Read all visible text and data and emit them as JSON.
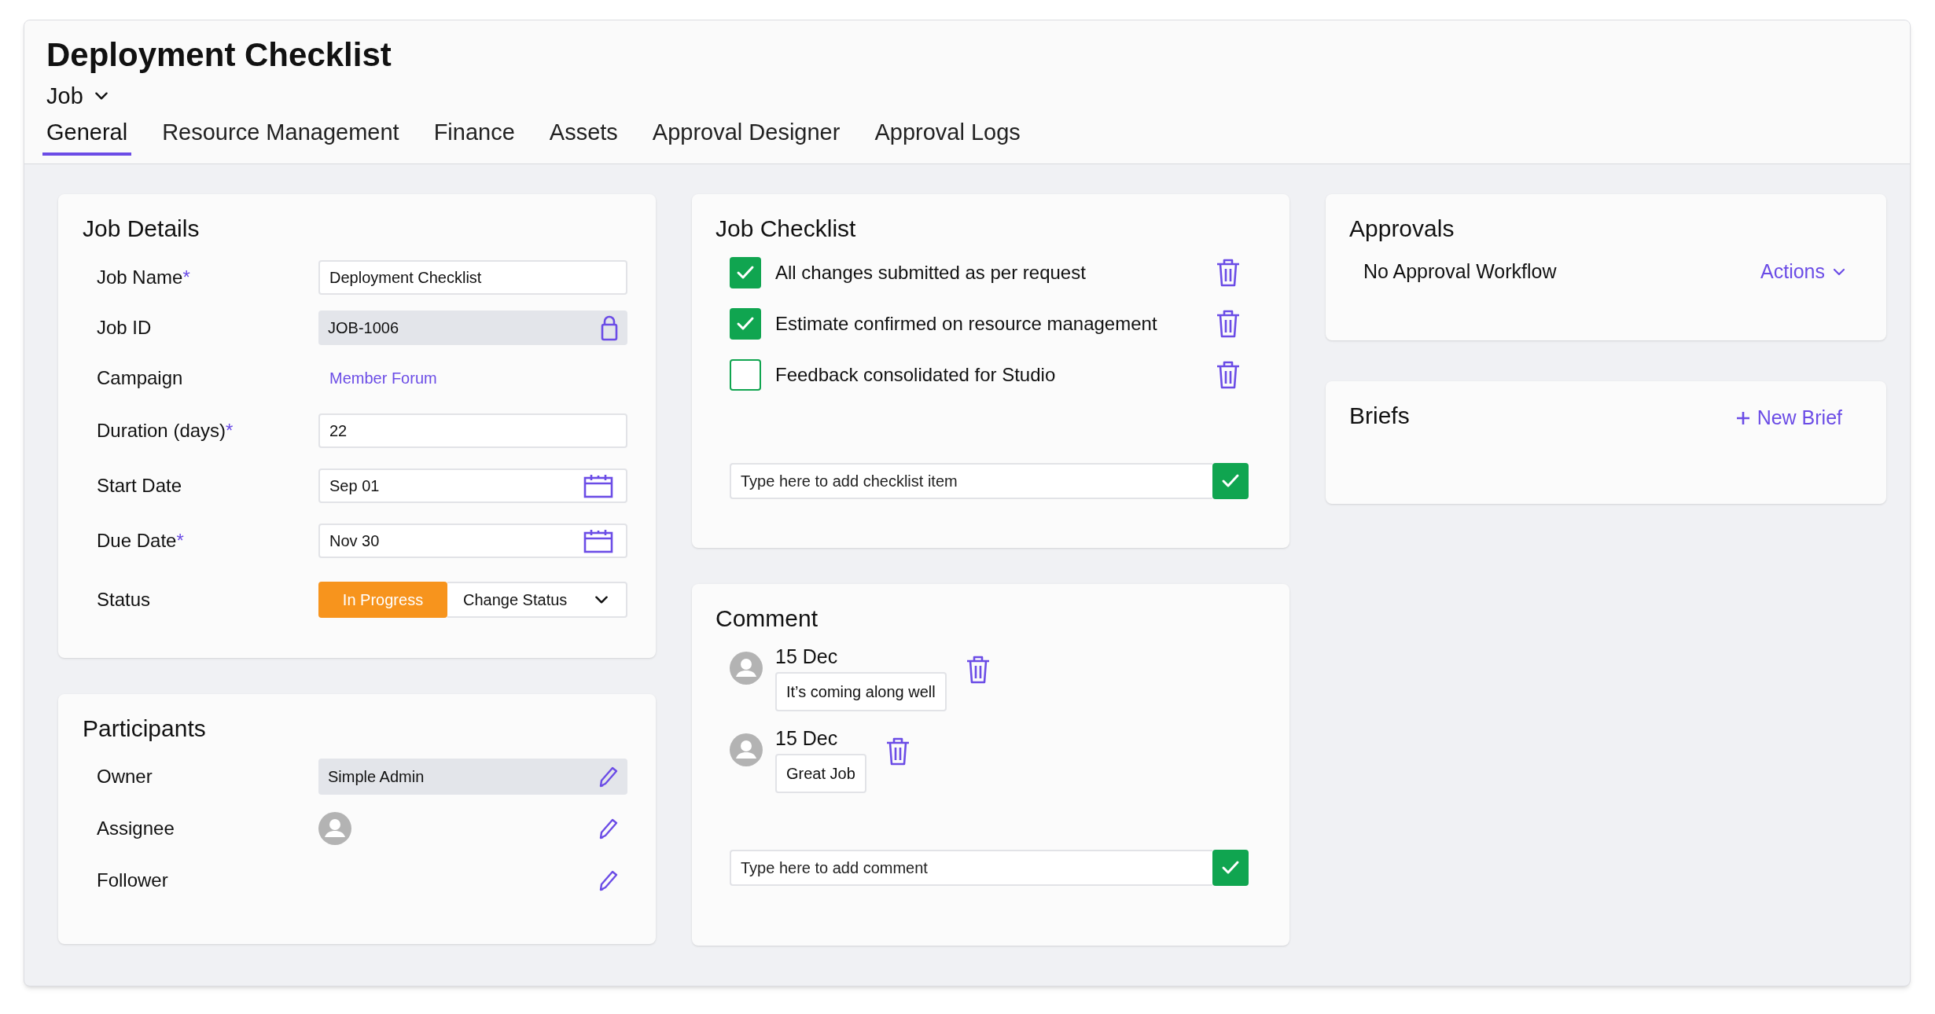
{
  "title": "Deployment Checklist",
  "record_type": {
    "label": "Job"
  },
  "tabs": [
    {
      "label": "General",
      "selected": true
    },
    {
      "label": "Resource Management",
      "selected": false
    },
    {
      "label": "Finance",
      "selected": false
    },
    {
      "label": "Assets",
      "selected": false
    },
    {
      "label": "Approval Designer",
      "selected": false
    },
    {
      "label": "Approval Logs",
      "selected": false
    }
  ],
  "job_details": {
    "title": "Job Details",
    "fields": [
      {
        "label": "Job Name",
        "required_mark": "*",
        "kind": "text",
        "value": "Deployment Checklist"
      },
      {
        "label": "Job ID",
        "kind": "locked",
        "value": "JOB-1006"
      },
      {
        "label": "Campaign",
        "kind": "link",
        "value": "Member Forum"
      },
      {
        "label": "Duration (days)",
        "required_mark": "*",
        "kind": "text",
        "value": "22"
      },
      {
        "label": "Start Date",
        "kind": "date",
        "value": "Sep 01"
      },
      {
        "label": "Due Date",
        "required_mark": "*",
        "kind": "date",
        "value": "Nov 30"
      },
      {
        "label": "Status",
        "kind": "status",
        "value": "In Progress",
        "action": "Change Status"
      }
    ]
  },
  "participants": {
    "title": "Participants",
    "rows": [
      {
        "label": "Owner",
        "kind": "field",
        "value": "Simple Admin"
      },
      {
        "label": "Assignee",
        "kind": "avatar"
      },
      {
        "label": "Follower",
        "kind": "empty"
      }
    ]
  },
  "job_checklist": {
    "title": "Job Checklist",
    "items": [
      {
        "text": "All changes submitted as per request",
        "checked": true
      },
      {
        "text": "Estimate confirmed on resource management",
        "checked": true
      },
      {
        "text": "Feedback consolidated for Studio",
        "checked": false
      }
    ],
    "placeholder": "Type here to add checklist item"
  },
  "comment": {
    "title": "Comment",
    "items": [
      {
        "date": "15 Dec",
        "text": "It’s coming along well"
      },
      {
        "date": "15 Dec",
        "text": "Great Job"
      }
    ],
    "placeholder": "Type here to add comment"
  },
  "approvals": {
    "title": "Approvals",
    "status": "No Approval Workflow",
    "action": "Actions"
  },
  "briefs": {
    "title": "Briefs",
    "action": "New Brief"
  }
}
